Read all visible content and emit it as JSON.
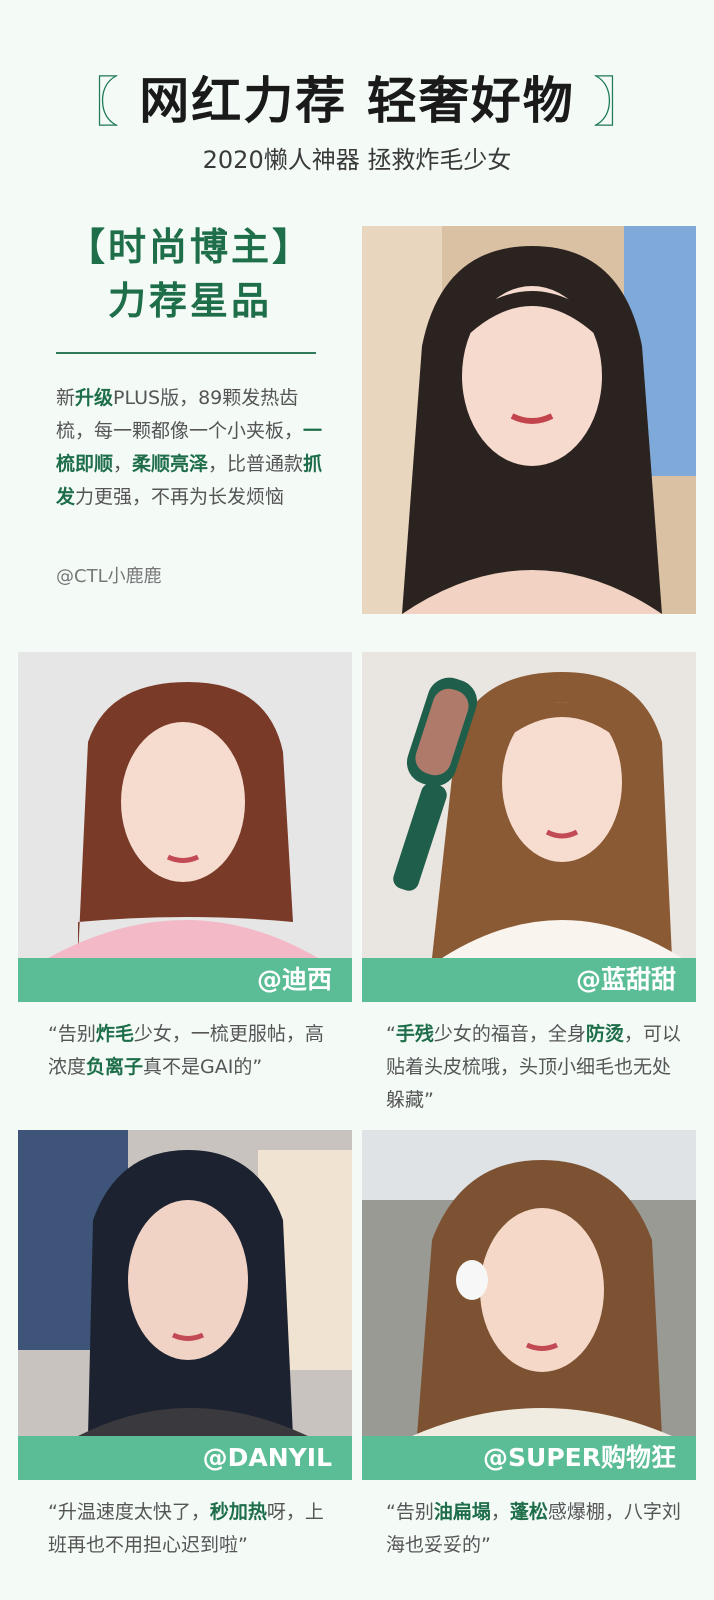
{
  "header": {
    "bracket_left": "〖",
    "title": "网红力荐 轻奢好物",
    "bracket_right": "〗",
    "subtitle": "2020懒人神器 拯救炸毛少女"
  },
  "intro": {
    "title_line1": "【时尚博主】",
    "title_line2": "力荐星品",
    "body": [
      {
        "t": "新"
      },
      {
        "t": "升级",
        "b": true
      },
      {
        "t": "PLUS版，89颗发热齿梳，每一颗都像一个小夹板，"
      },
      {
        "t": "一梳即顺",
        "b": true
      },
      {
        "t": "，"
      },
      {
        "t": "柔顺亮泽",
        "b": true
      },
      {
        "t": "，比普通款"
      },
      {
        "t": "抓发",
        "b": true
      },
      {
        "t": "力更强，不再为长发烦恼"
      }
    ],
    "credit": "@CTL小鹿鹿"
  },
  "cards": [
    {
      "name": "@迪西",
      "quote": [
        {
          "t": "“告别"
        },
        {
          "t": "炸毛",
          "b": true
        },
        {
          "t": "少女，一梳更服帖，高浓度"
        },
        {
          "t": "负离子",
          "b": true
        },
        {
          "t": "真不是GAI的”"
        }
      ]
    },
    {
      "name": "@蓝甜甜",
      "quote": [
        {
          "t": "“"
        },
        {
          "t": "手残",
          "b": true
        },
        {
          "t": "少女的福音，全身"
        },
        {
          "t": "防烫",
          "b": true
        },
        {
          "t": "，可以贴着头皮梳哦，头顶小细毛也无处躲藏”"
        }
      ]
    },
    {
      "name": "@DANYIL",
      "quote": [
        {
          "t": "“升温速度太快了，"
        },
        {
          "t": "秒加热",
          "b": true
        },
        {
          "t": "呀，上班再也不用担心迟到啦”"
        }
      ]
    },
    {
      "name": "@SUPER购物狂",
      "quote": [
        {
          "t": "“告别"
        },
        {
          "t": "油扁塌",
          "b": true
        },
        {
          "t": "，"
        },
        {
          "t": "蓬松",
          "b": true
        },
        {
          "t": "感爆棚，八字刘海也妥妥的”"
        }
      ]
    }
  ],
  "colors": {
    "accent": "#5bbd95",
    "dark_green": "#1f6e4a",
    "background": "#f4fbf7"
  }
}
